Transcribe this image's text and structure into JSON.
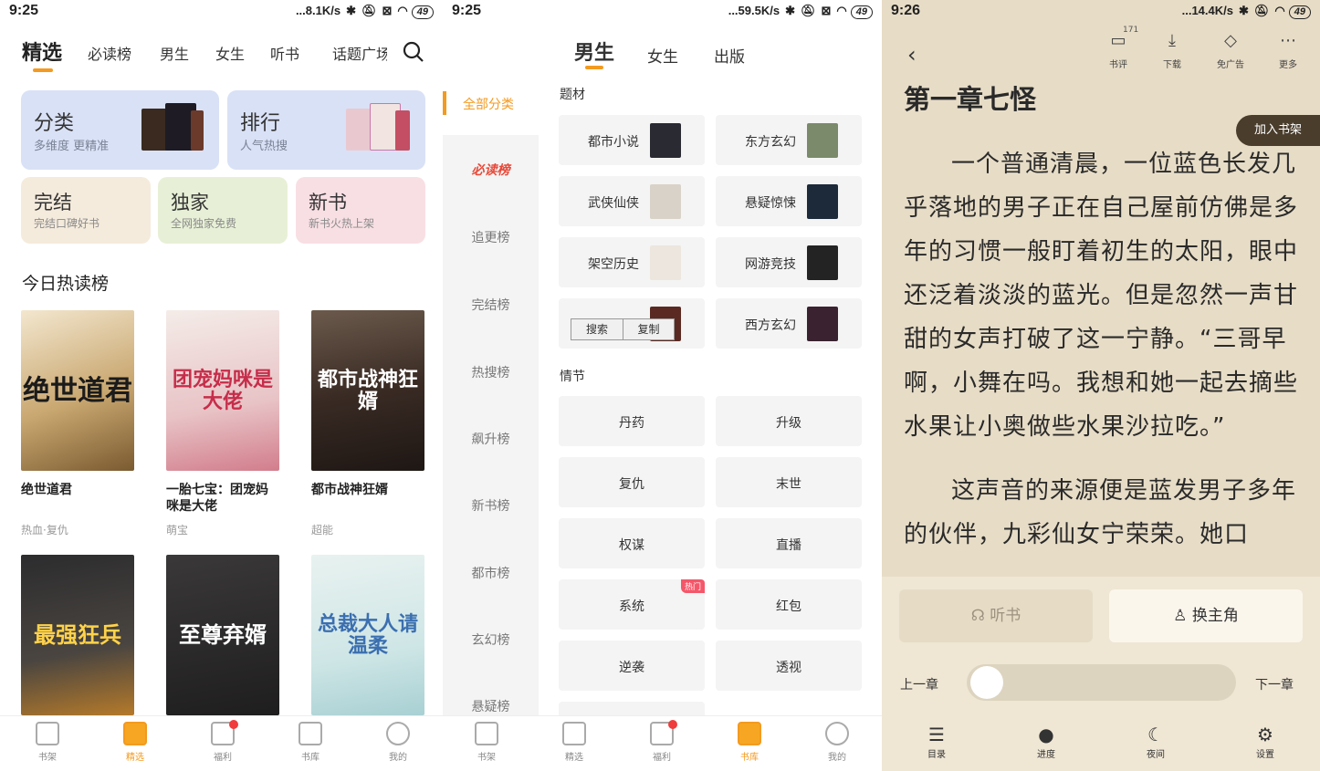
{
  "panel1": {
    "status": {
      "time": "9:25",
      "net": "...8.1K/s",
      "battery": "49"
    },
    "tabs": [
      "精选",
      "必读榜",
      "男生",
      "女生",
      "听书",
      "话题广场"
    ],
    "cards_big": [
      {
        "title": "分类",
        "subtitle": "多维度 更精准"
      },
      {
        "title": "排行",
        "subtitle": "人气热搜"
      }
    ],
    "cards_small": [
      {
        "title": "完结",
        "subtitle": "完结口碑好书"
      },
      {
        "title": "独家",
        "subtitle": "全网独家免费"
      },
      {
        "title": "新书",
        "subtitle": "新书火热上架"
      }
    ],
    "section_title": "今日热读榜",
    "books": [
      {
        "title": "绝世道君",
        "tag": "热血·复仇",
        "cover_text": "绝世道君"
      },
      {
        "title": "一胎七宝：团宠妈咪是大佬",
        "tag": "萌宝",
        "cover_text": "团宠妈咪是大佬"
      },
      {
        "title": "都市战神狂婿",
        "tag": "超能",
        "cover_text": "都市战神狂婿"
      }
    ],
    "books_row2": [
      {
        "cover_text": "最强狂兵"
      },
      {
        "cover_text": "至尊弃婿"
      },
      {
        "cover_text": "总裁大人请温柔"
      }
    ],
    "nav": [
      "书架",
      "精选",
      "福利",
      "书库",
      "我的"
    ]
  },
  "panel2": {
    "status": {
      "time": "9:25",
      "net": "...59.5K/s",
      "battery": "49"
    },
    "tabs": [
      "男生",
      "女生",
      "出版"
    ],
    "sidebar": [
      "全部分类",
      "必读榜",
      "追更榜",
      "完结榜",
      "热搜榜",
      "飙升榜",
      "新书榜",
      "都市榜",
      "玄幻榜",
      "悬疑榜"
    ],
    "group1_title": "题材",
    "group1": [
      "都市小说",
      "东方玄幻",
      "武侠仙侠",
      "悬疑惊悚",
      "架空历史",
      "网游竞技",
      "",
      "西方玄幻"
    ],
    "context_menu": [
      "搜索",
      "复制"
    ],
    "group2_title": "情节",
    "group2": [
      "丹药",
      "升级",
      "复仇",
      "末世",
      "权谋",
      "直播",
      "系统",
      "红包",
      "逆袭",
      "透视"
    ],
    "hot_badge": "热门",
    "nav": [
      "书架",
      "精选",
      "福利",
      "书库",
      "我的"
    ]
  },
  "panel3": {
    "status": {
      "time": "9:26",
      "net": "...14.4K/s",
      "battery": "49"
    },
    "actions": [
      "书评",
      "下载",
      "免广告",
      "更多"
    ],
    "review_count": "171",
    "chapter_title": "第一章七怪",
    "add_shelf": "加入书架",
    "paragraphs": [
      "一个普通清晨，一位蓝色长发几乎落地的男子正在自己屋前仿佛是多年的习惯一般盯着初生的太阳，眼中还泛着淡淡的蓝光。但是忽然一声甘甜的女声打破了这一宁静。“三哥早啊，小舞在吗。我想和她一起去摘些水果让小奥做些水果沙拉吃。”",
      "这声音的来源便是蓝发男子多年的伙伴，九彩仙女宁荣荣。她口"
    ],
    "listen_label": "听书",
    "switch_label": "换主角",
    "prev_chapter": "上一章",
    "next_chapter": "下一章",
    "tools": [
      "目录",
      "进度",
      "夜间",
      "设置"
    ]
  }
}
